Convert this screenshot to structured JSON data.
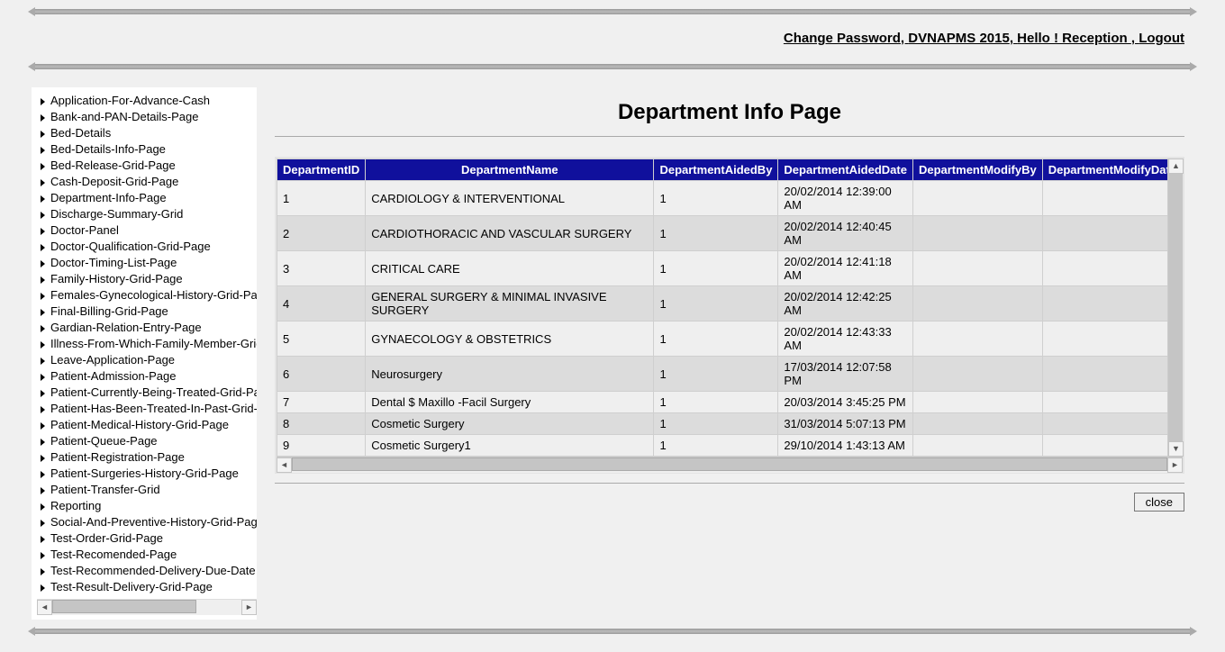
{
  "top_links": {
    "change_password": "Change Password",
    "app": "DVNAPMS 2015",
    "greeting": "Hello ! Reception ",
    "logout": "Logout"
  },
  "page_title": "Department Info Page",
  "close_label": "close",
  "sidebar": {
    "items": [
      "Application-For-Advance-Cash",
      "Bank-and-PAN-Details-Page",
      "Bed-Details",
      "Bed-Details-Info-Page",
      "Bed-Release-Grid-Page",
      "Cash-Deposit-Grid-Page",
      "Department-Info-Page",
      "Discharge-Summary-Grid",
      "Doctor-Panel",
      "Doctor-Qualification-Grid-Page",
      "Doctor-Timing-List-Page",
      "Family-History-Grid-Page",
      "Females-Gynecological-History-Grid-Page",
      "Final-Billing-Grid-Page",
      "Gardian-Relation-Entry-Page",
      "Illness-From-Which-Family-Member-Grid",
      "Leave-Application-Page",
      "Patient-Admission-Page",
      "Patient-Currently-Being-Treated-Grid-Page",
      "Patient-Has-Been-Treated-In-Past-Grid-Page",
      "Patient-Medical-History-Grid-Page",
      "Patient-Queue-Page",
      "Patient-Registration-Page",
      "Patient-Surgeries-History-Grid-Page",
      "Patient-Transfer-Grid",
      "Reporting",
      "Social-And-Preventive-History-Grid-Page",
      "Test-Order-Grid-Page",
      "Test-Recomended-Page",
      "Test-Recommended-Delivery-Due-Date",
      "Test-Result-Delivery-Grid-Page"
    ]
  },
  "grid": {
    "columns": [
      "DepartmentID",
      "DepartmentName",
      "DepartmentAidedBy",
      "DepartmentAidedDate",
      "DepartmentModifyBy",
      "DepartmentModifyDate"
    ],
    "rows": [
      {
        "id": "1",
        "name": "CARDIOLOGY & INTERVENTIONAL",
        "aided_by": "1",
        "aided_date": "20/02/2014 12:39:00 AM",
        "mod_by": "",
        "mod_date": ""
      },
      {
        "id": "2",
        "name": "CARDIOTHORACIC AND VASCULAR SURGERY",
        "aided_by": "1",
        "aided_date": "20/02/2014 12:40:45 AM",
        "mod_by": "",
        "mod_date": ""
      },
      {
        "id": "3",
        "name": "CRITICAL CARE",
        "aided_by": "1",
        "aided_date": "20/02/2014 12:41:18 AM",
        "mod_by": "",
        "mod_date": ""
      },
      {
        "id": "4",
        "name": "GENERAL SURGERY & MINIMAL INVASIVE SURGERY",
        "aided_by": "1",
        "aided_date": "20/02/2014 12:42:25 AM",
        "mod_by": "",
        "mod_date": ""
      },
      {
        "id": "5",
        "name": "GYNAECOLOGY & OBSTETRICS",
        "aided_by": "1",
        "aided_date": "20/02/2014 12:43:33 AM",
        "mod_by": "",
        "mod_date": ""
      },
      {
        "id": "6",
        "name": "Neurosurgery",
        "aided_by": "1",
        "aided_date": "17/03/2014 12:07:58 PM",
        "mod_by": "",
        "mod_date": ""
      },
      {
        "id": "7",
        "name": "Dental $ Maxillo -Facil Surgery",
        "aided_by": "1",
        "aided_date": "20/03/2014 3:45:25 PM",
        "mod_by": "",
        "mod_date": ""
      },
      {
        "id": "8",
        "name": "Cosmetic Surgery",
        "aided_by": "1",
        "aided_date": "31/03/2014 5:07:13 PM",
        "mod_by": "",
        "mod_date": ""
      },
      {
        "id": "9",
        "name": "Cosmetic Surgery1",
        "aided_by": "1",
        "aided_date": "29/10/2014 1:43:13 AM",
        "mod_by": "",
        "mod_date": ""
      }
    ]
  }
}
